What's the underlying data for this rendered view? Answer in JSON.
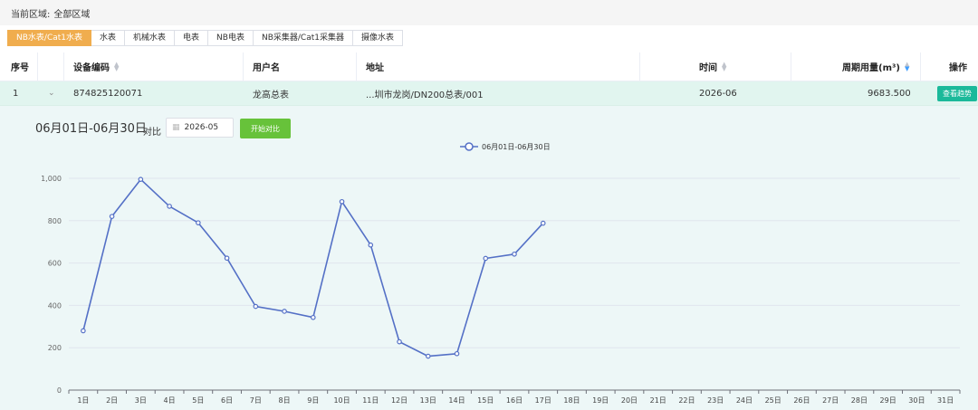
{
  "region": {
    "label": "当前区域:",
    "value": "全部区域"
  },
  "tabs": [
    {
      "label": "NB水表/Cat1水表",
      "active": true
    },
    {
      "label": "水表",
      "active": false
    },
    {
      "label": "机械水表",
      "active": false
    },
    {
      "label": "电表",
      "active": false
    },
    {
      "label": "NB电表",
      "active": false
    },
    {
      "label": "NB采集器/Cat1采集器",
      "active": false
    },
    {
      "label": "摄像水表",
      "active": false
    }
  ],
  "table": {
    "headers": {
      "index": "序号",
      "device_code": "设备编码",
      "user_name": "用户名",
      "address": "地址",
      "time": "时间",
      "period_usage": "周期用量(m³)",
      "action": "操作"
    },
    "rows": [
      {
        "index": "1",
        "device_code": "874825120071",
        "user_name": "龙高总表",
        "address": "...圳市龙岗/DN200总表/001",
        "time": "2026-06",
        "period_usage": "9683.500",
        "action_label": "查看趋势"
      }
    ]
  },
  "detail": {
    "period_title": "06月01日-06月30日",
    "compare_label": "对比",
    "compare_date": "2026-05",
    "start_compare_label": "开始对比"
  },
  "chart_data": {
    "type": "line",
    "legend": [
      "06月01日-06月30日"
    ],
    "legend_position": "top-center",
    "categories": [
      "1日",
      "2日",
      "3日",
      "4日",
      "5日",
      "6日",
      "7日",
      "8日",
      "9日",
      "10日",
      "11日",
      "12日",
      "13日",
      "14日",
      "15日",
      "16日",
      "17日",
      "18日",
      "19日",
      "20日",
      "21日",
      "22日",
      "23日",
      "24日",
      "25日",
      "26日",
      "27日",
      "28日",
      "29日",
      "30日",
      "31日"
    ],
    "series": [
      {
        "name": "06月01日-06月30日",
        "values": [
          280,
          820,
          995,
          868,
          790,
          623,
          395,
          372,
          343,
          890,
          685,
          228,
          160,
          172,
          622,
          642,
          788
        ]
      }
    ],
    "ylim": [
      0,
      1000
    ],
    "yticks": [
      0,
      200,
      400,
      600,
      800,
      1000
    ],
    "ytick_labels": [
      "0",
      "200",
      "400",
      "600",
      "800",
      "1,000"
    ],
    "grid": true,
    "colors": {
      "line": "#5470c6"
    }
  }
}
